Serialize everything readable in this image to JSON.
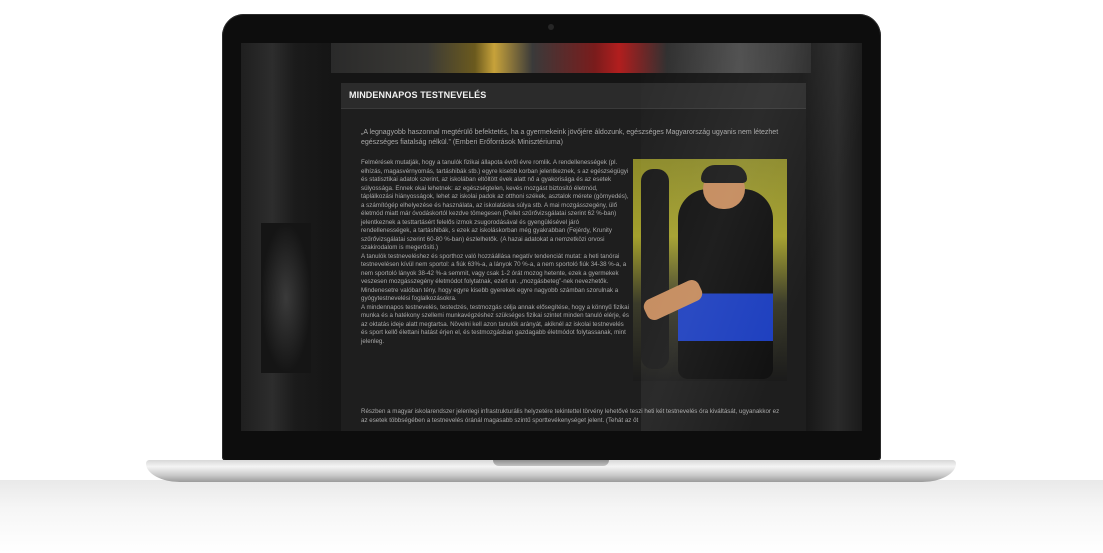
{
  "page": {
    "title": "MINDENNAPOS TESTNEVELÉS",
    "quote": "„A legnagyobb haszonnal megtérülő befektetés, ha a gyermekeink jövőjére áldozunk, egészséges Magyarország ugyanis nem létezhet egészséges fiatalság nélkül.” (Emberi Erőforrások Minisztériuma)",
    "paragraphs": [
      "Felmérések mutatják, hogy a tanulók fizikai állapota évről évre romlik. A rendellenességek (pl. elhízás, magasvérnyomás, tartáshibák stb.) egyre kisebb korban jelentkeznek, s az egészségügyi és statisztikai adatok szerint, az iskolában eltöltött évek alatt nő a gyakorisága és az esetek súlyossága. Ennek okai lehetnek: az egészségtelen, kevés mozgást biztosító életmód, táplálkozási hiányosságok, lehet az iskolai padok az otthoni székek, asztalok mérete (görnyedés), a számítógép elhelyezése és használata, az iskolatáska súlya stb. A mai mozgásszegény, ülő életmód miatt már óvodáskortól kezdve tömegesen (Pellet szűrővizsgálatai szerint 62 %-ban) jelentkeznek a testtartásért felelős izmok zsugorodásával és gyengülésével járó rendellenességek, a tartáshibák, s ezek az iskoláskorban még gyakrabban (Fejérdy, Krunity szűrővizsgálatai szerint 60-80 %-ban) észlelhetők. (A hazai adatokat a nemzetközi orvosi szakirodalom is megerősíti.)",
      "A tanulók testneveléshez és sporthoz való hozzáállása negatív tendenciát mutat: a heti tanórai testnevelésen kívül nem sportol: a fiúk 63%-a, a lányok 70 %-a, a nem sportoló fiúk 34-38 %-a, a nem sportoló lányok 38-42 %-a semmit, vagy csak 1-2 órát mozog hetente, ezek a gyermekek veszesen mozgásszegény életmódot folytatnak, ezért un. „mozgásbeteg”-nek nevezhetők. Mindenesetre valóban tény, hogy egyre kisebb gyerekek egyre nagyobb számban szorulnak a gyógytestnevelési foglalkozásokra.",
      "A mindennapos testnevelés, testedzés, testmozgás célja annak elősegítése, hogy a könnyű fizikai munka és a hatékony szellemi munkavégzéshez szükséges fizikai szintet minden tanuló elérje, és az oktatás ideje alatt megtartsa. Növelni kell azon tanulók arányát, akiknél az iskolai testnevelés és sport kellő élettani hatást érjen el, és testmozgásban gazdagabb életmódot folytassanak, mint jelenleg."
    ],
    "wide_paragraph": "Részben a magyar iskolarendszer jelenlegi infrastrukturális helyzetére tekintettel törvény lehetővé teszi heti két testnevelés óra kiváltását, ugyanakkor ez az esetek többségében a testnevelés óránál magasabb szintű sporttevékenységet jelent. (Tehát az öt",
    "accent_color": "#f2f2f2",
    "text_color": "#a9a9a9"
  }
}
